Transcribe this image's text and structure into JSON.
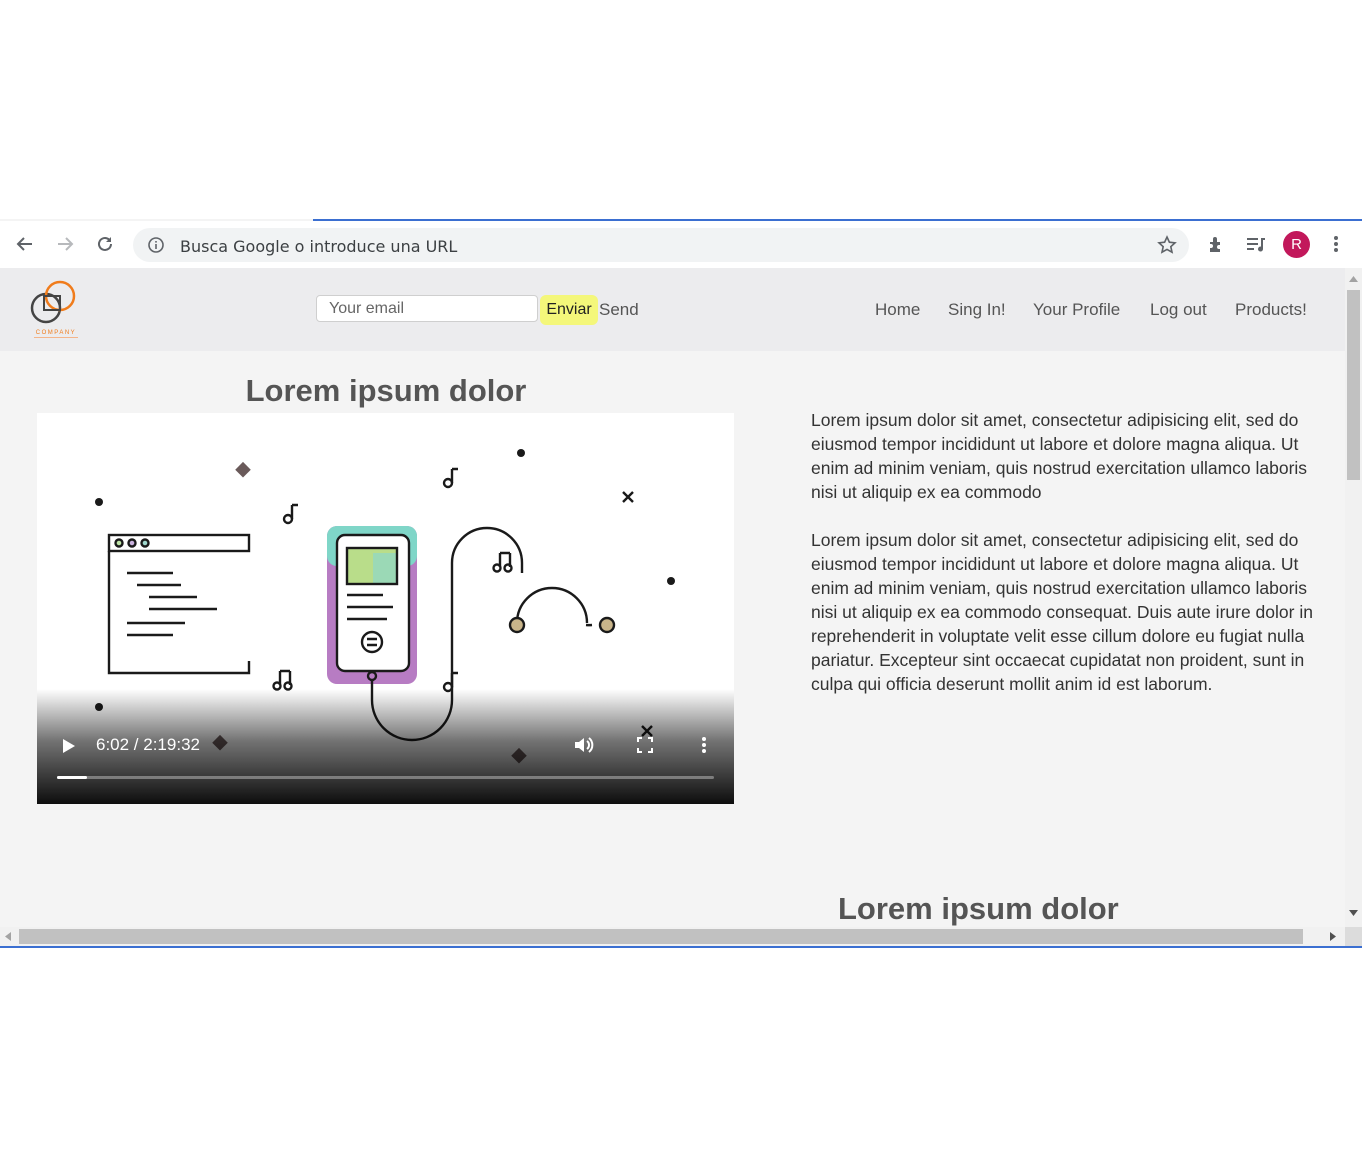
{
  "browser": {
    "address_placeholder": "Busca Google o introduce una URL",
    "profile_initial": "R",
    "profile_color": "#c2185b",
    "icons": [
      "back-icon",
      "forward-icon",
      "reload-icon",
      "info-icon",
      "star-icon",
      "extensions-icon",
      "media-queue-icon",
      "more-icon"
    ]
  },
  "site": {
    "email_placeholder": "Your email",
    "enviar_label": "Enviar",
    "send_label": "Send",
    "nav": [
      "Home",
      "Sing In!",
      "Your Profile",
      "Log out",
      "Products!"
    ],
    "heading_left": "Lorem ipsum dolor",
    "video": {
      "time": "6:02 / 2:19:32",
      "progress": 0.046
    },
    "paragraph1": "Lorem ipsum dolor sit amet, consectetur adipisicing elit, sed do eiusmod tempor incididunt ut labore et dolore magna aliqua. Ut enim ad minim veniam, quis nostrud exercitation ullamco laboris nisi ut aliquip ex ea commodo",
    "paragraph2": "Lorem ipsum dolor sit amet, consectetur adipisicing elit, sed do eiusmod tempor incididunt ut labore et dolore magna aliqua. Ut enim ad minim veniam, quis nostrud exercitation ullamco laboris nisi ut aliquip ex ea commodo consequat. Duis aute irure dolor in reprehenderit in voluptate velit esse cillum dolore eu fugiat nulla pariatur. Excepteur sint occaecat cupidatat non proident, sunt in culpa qui officia deserunt mollit anim id est laborum.",
    "heading_right": "Lorem ipsum dolor",
    "accent_color": "#f4f77a",
    "logo_color": "#f07c1c"
  }
}
